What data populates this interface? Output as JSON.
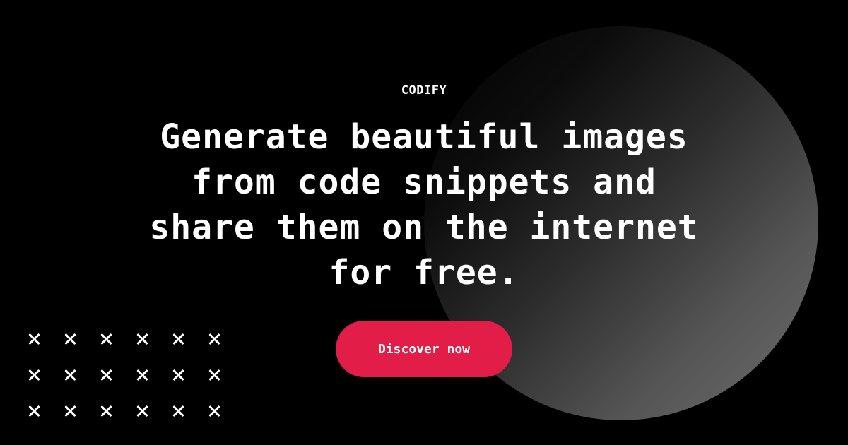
{
  "brand": {
    "name": "CODIFY"
  },
  "hero": {
    "headline_lines": [
      "Generate beautiful images",
      "from code snippets and",
      "share them on the internet",
      "for free."
    ],
    "cta_label": "Discover now"
  },
  "decoration": {
    "pattern_icon": "x-mark-icon",
    "pattern_rows": 3,
    "pattern_columns": 6,
    "circle": "gradient-circle"
  },
  "colors": {
    "background": "#000000",
    "text": "#ffffff",
    "accent": "#e11d48",
    "circle_gradient_start": "#000000",
    "circle_gradient_end": "#6e6e6e"
  }
}
